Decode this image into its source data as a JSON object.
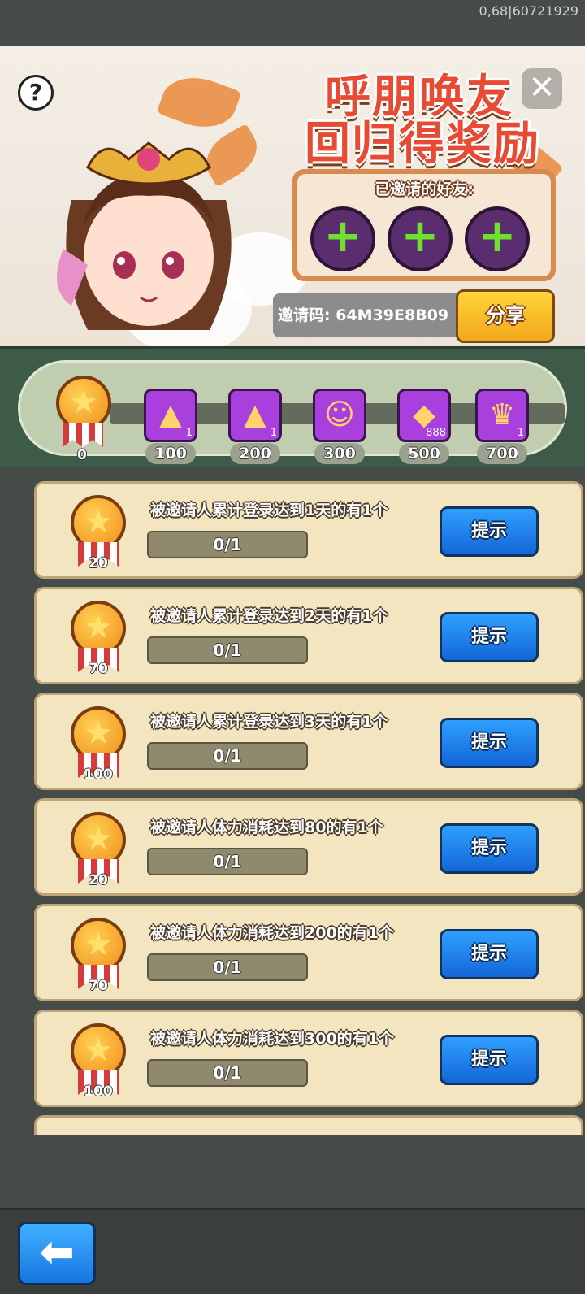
{
  "status": {
    "text": "0,68|60721929"
  },
  "banner": {
    "title_line1": "呼朋唤友",
    "title_line2": "回归得奖励",
    "help_icon": "?",
    "close_icon": "✕",
    "invited_label": "已邀请的好友:",
    "slot_icon": "+",
    "invite_code": "邀请码: 64M39E8B09",
    "share_label": "分享"
  },
  "progress": {
    "current": "0",
    "milestones": [
      {
        "score": "100",
        "qty": "1",
        "icon": "chest-upgrade-icon"
      },
      {
        "score": "200",
        "qty": "1",
        "icon": "chest-upgrade-icon"
      },
      {
        "score": "300",
        "qty": "",
        "icon": "hero-portrait-icon"
      },
      {
        "score": "500",
        "qty": "888",
        "icon": "gold-ingot-icon"
      },
      {
        "score": "700",
        "qty": "1",
        "icon": "crown-badge-icon"
      }
    ]
  },
  "tasks": [
    {
      "desc": "被邀请人累计登录达到1天的有1个",
      "points": "20",
      "progress": "0/1",
      "button": "提示"
    },
    {
      "desc": "被邀请人累计登录达到2天的有1个",
      "points": "70",
      "progress": "0/1",
      "button": "提示"
    },
    {
      "desc": "被邀请人累计登录达到3天的有1个",
      "points": "100",
      "progress": "0/1",
      "button": "提示"
    },
    {
      "desc": "被邀请人体力消耗达到80的有1个",
      "points": "20",
      "progress": "0/1",
      "button": "提示"
    },
    {
      "desc": "被邀请人体力消耗达到200的有1个",
      "points": "70",
      "progress": "0/1",
      "button": "提示"
    },
    {
      "desc": "被邀请人体力消耗达到300的有1个",
      "points": "100",
      "progress": "0/1",
      "button": "提示"
    }
  ],
  "back_icon": "arrow-left-icon"
}
